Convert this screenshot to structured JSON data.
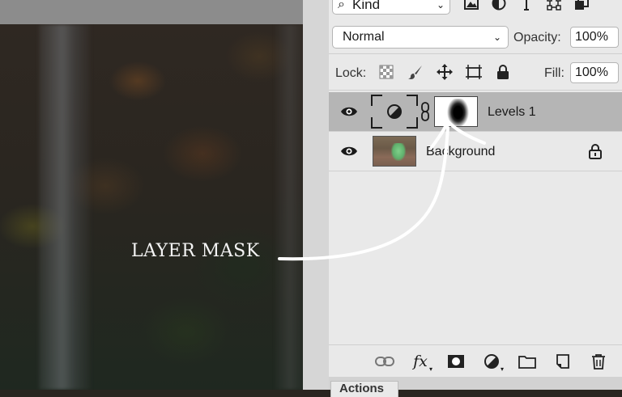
{
  "canvas": {
    "annotation": "LAYER MASK"
  },
  "layers_panel": {
    "filter": {
      "label": "Kind"
    },
    "blend_mode": "Normal",
    "opacity_label": "Opacity:",
    "opacity_value": "100%",
    "lock_label": "Lock:",
    "fill_label": "Fill:",
    "fill_value": "100%",
    "layers": [
      {
        "name": "Levels 1",
        "selected": true,
        "visible": true
      },
      {
        "name": "Background",
        "selected": false,
        "visible": true,
        "locked": true
      }
    ],
    "bottom_bar": {
      "fx_label": "fx"
    },
    "tab": "Actions"
  },
  "colors": {
    "selected_row": "#b5b5b5",
    "panel_bg": "#e9e9e9",
    "annotation_stroke": "#ffffff"
  }
}
